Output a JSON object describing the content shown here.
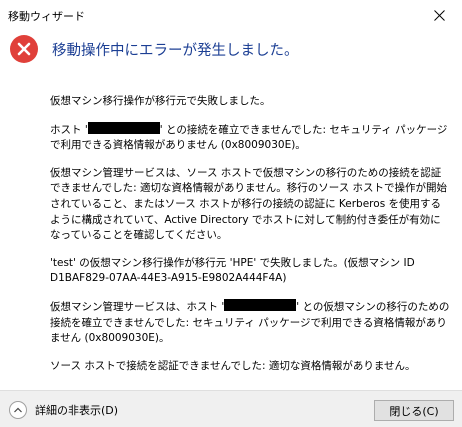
{
  "window": {
    "title": "移動ウィザード"
  },
  "header": {
    "icon": "error-icon",
    "heading": "移動操作中にエラーが発生しました。"
  },
  "messages": {
    "p1": "仮想マシン移行操作が移行元で失敗しました。",
    "p2_prefix": "ホスト '",
    "p2_suffix": "' との接続を確立できませんでした: セキュリティ パッケージで利用できる資格情報がありません (0x8009030E)。",
    "p3": "仮想マシン管理サービスは、ソース ホストで仮想マシンの移行のための接続を認証できませんでした: 適切な資格情報がありません。移行のソース ホストで操作が開始されていること、またはソース ホストが移行の接続の認証に Kerberos を使用するように構成されていて、Active Directory でホストに対して制約付き委任が有効になっていることを確認してください。",
    "p4": "'test' の仮想マシン移行操作が移行元 'HPE' で失敗しました。(仮想マシン ID D1BAF829-07AA-44E3-A915-E9802A444F4A)",
    "p5_prefix": "仮想マシン管理サービスは、ホスト '",
    "p5_suffix": "' との仮想マシンの移行のための接続を確立できませんでした: セキュリティ パッケージで利用できる資格情報がありません (0x8009030E)。",
    "p6": "ソース ホストで接続を認証できませんでした: 適切な資格情報がありません。"
  },
  "footer": {
    "details_label": "詳細の非表示(D)",
    "close_label": "閉じる(C)"
  },
  "colors": {
    "heading": "#1c3f94",
    "error_red": "#e0403a",
    "footer_bg": "#f0f0f0"
  }
}
